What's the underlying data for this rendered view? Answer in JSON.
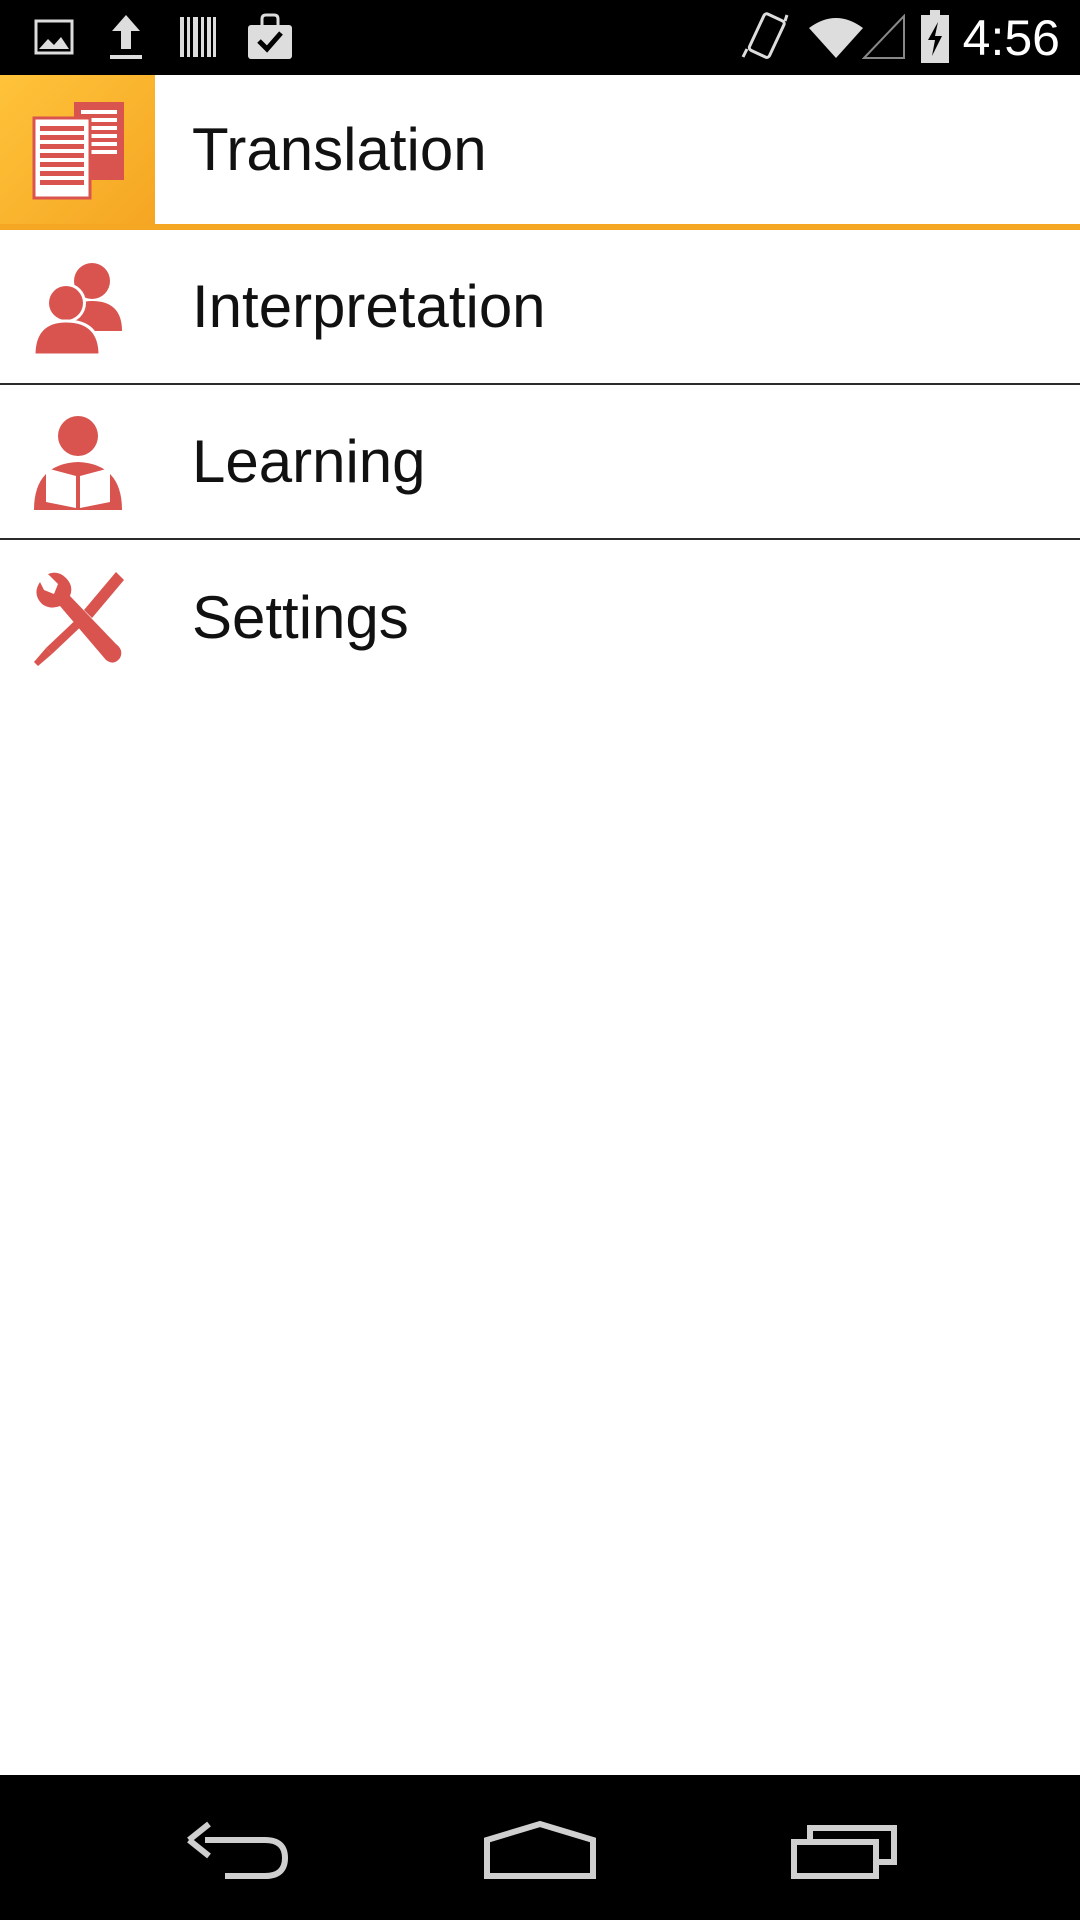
{
  "status_bar": {
    "time": "4:56",
    "left_icons": [
      "gallery-icon",
      "upload-icon",
      "barcode-icon",
      "shopping-bag-check-icon"
    ],
    "right_icons": [
      "vibrate-icon",
      "wifi-icon",
      "signal-icon",
      "battery-charging-icon"
    ]
  },
  "menu": {
    "items": [
      {
        "label": "Translation",
        "icon": "documents-icon",
        "selected": true
      },
      {
        "label": "Interpretation",
        "icon": "people-icon",
        "selected": false
      },
      {
        "label": "Learning",
        "icon": "reader-icon",
        "selected": false
      },
      {
        "label": "Settings",
        "icon": "tools-icon",
        "selected": false
      }
    ]
  },
  "colors": {
    "accent": "#f5a623",
    "icon_red": "#d9534f",
    "status_bar": "#000000",
    "nav_bar": "#000000"
  },
  "nav_bar": {
    "buttons": [
      "back-icon",
      "home-icon",
      "recents-icon"
    ]
  }
}
